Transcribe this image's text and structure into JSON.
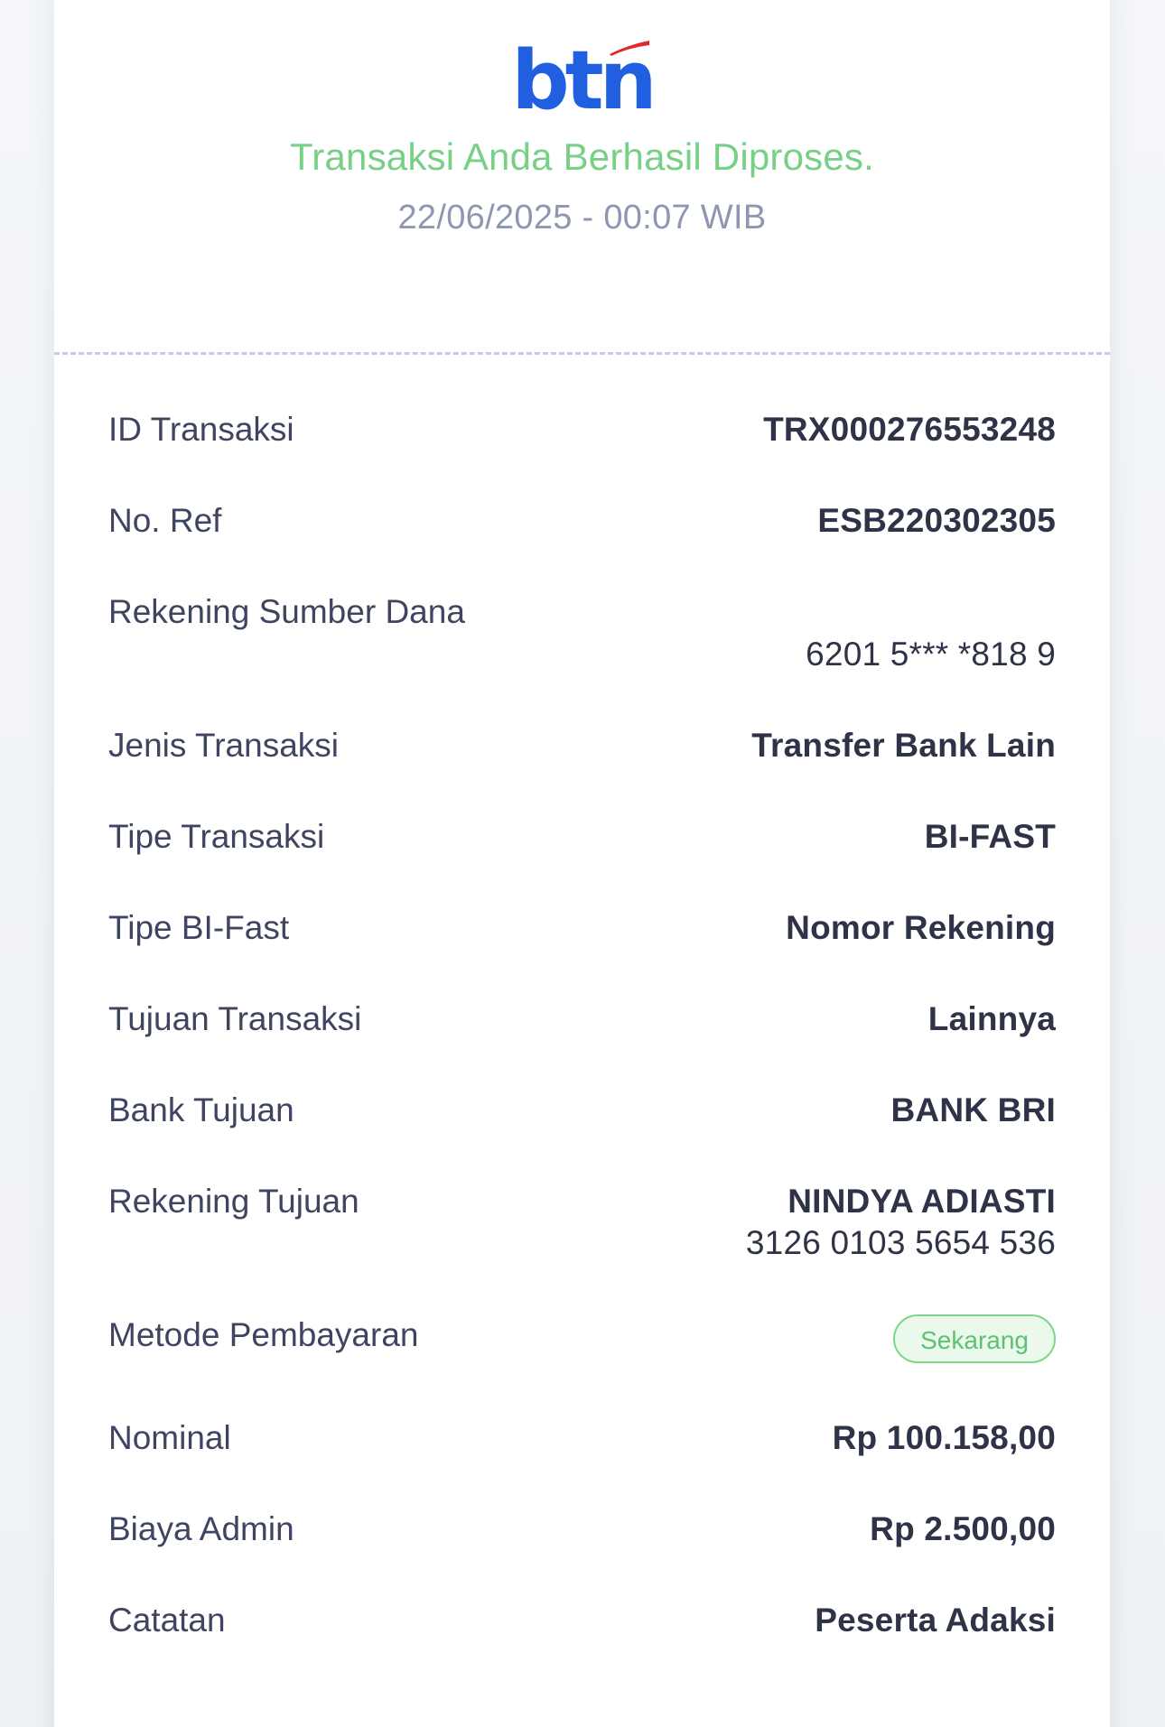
{
  "brand": {
    "logo_text": "btn",
    "logo_color": "#1f5fe0",
    "swoosh_color": "#e3262b"
  },
  "status": {
    "headline": "Transaksi Anda Berhasil Diproses.",
    "datetime": "22/06/2025 - 00:07 WIB"
  },
  "details": {
    "id_transaksi": {
      "label": "ID Transaksi",
      "value": "TRX000276553248"
    },
    "no_ref": {
      "label": "No. Ref",
      "value": "ESB220302305"
    },
    "rekening_sumber": {
      "label": "Rekening Sumber Dana",
      "value": "6201 5*** *818 9"
    },
    "jenis_transaksi": {
      "label": "Jenis Transaksi",
      "value": "Transfer Bank Lain"
    },
    "tipe_transaksi": {
      "label": "Tipe Transaksi",
      "value": "BI-FAST"
    },
    "tipe_bifast": {
      "label": "Tipe BI-Fast",
      "value": "Nomor Rekening"
    },
    "tujuan_transaksi": {
      "label": "Tujuan Transaksi",
      "value": "Lainnya"
    },
    "bank_tujuan": {
      "label": "Bank Tujuan",
      "value": "BANK BRI"
    },
    "rekening_tujuan": {
      "label": "Rekening Tujuan",
      "name": "NINDYA ADIASTI",
      "number": "3126 0103 5654 536"
    },
    "metode_pembayaran": {
      "label": "Metode Pembayaran",
      "badge": "Sekarang"
    },
    "nominal": {
      "label": "Nominal",
      "value": "Rp 100.158,00"
    },
    "biaya_admin": {
      "label": "Biaya Admin",
      "value": "Rp 2.500,00"
    },
    "catatan": {
      "label": "Catatan",
      "value": "Peserta Adaksi"
    }
  },
  "colors": {
    "success": "#78cf86",
    "muted": "#8e97b2",
    "divider": "#c8cbe6"
  }
}
